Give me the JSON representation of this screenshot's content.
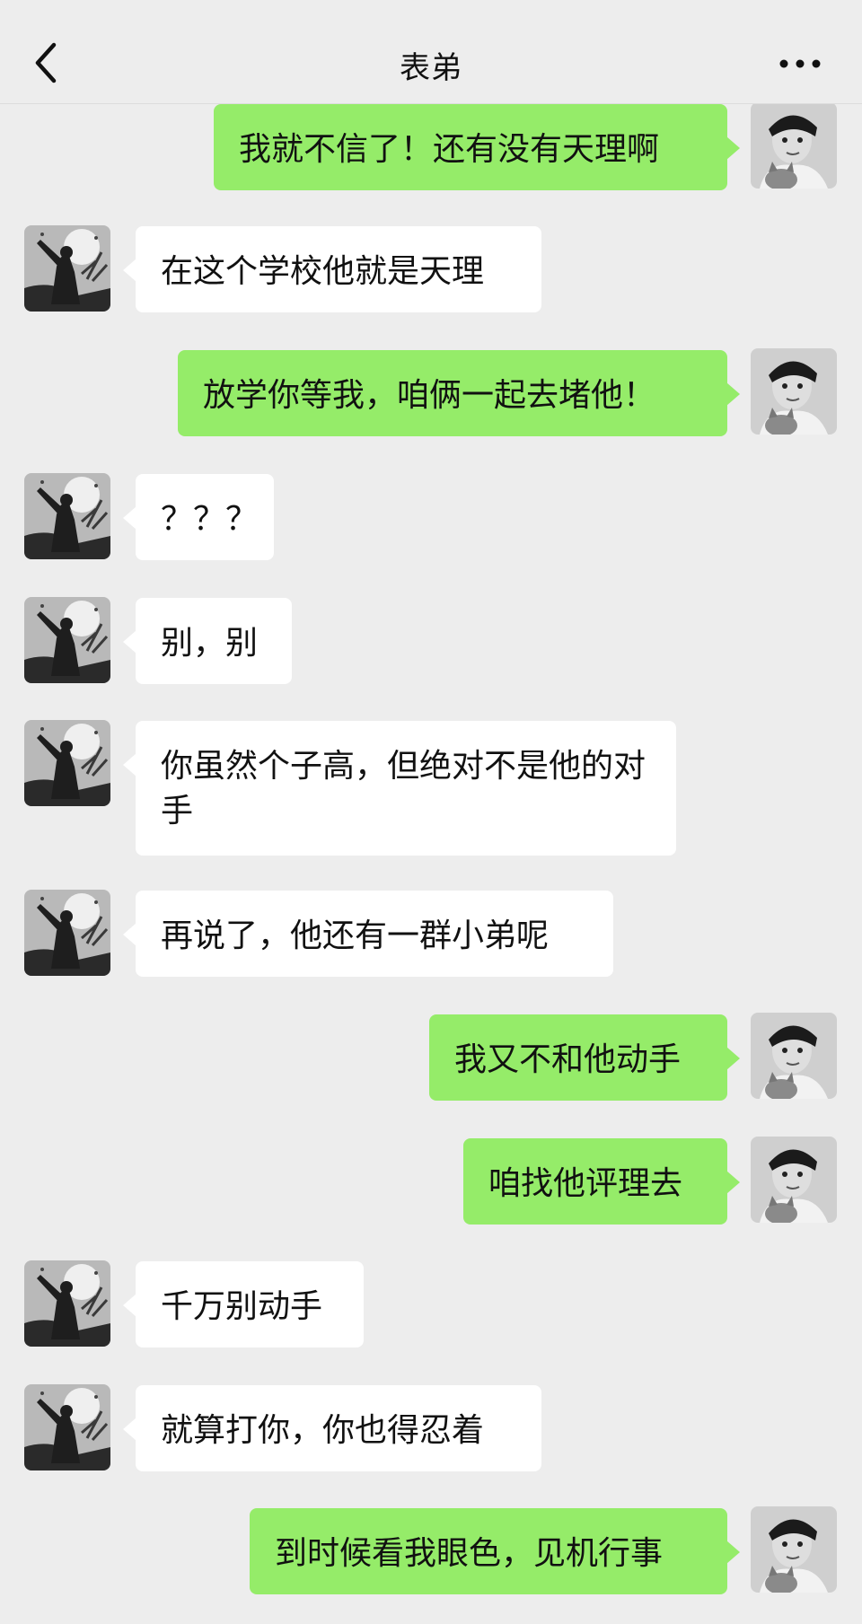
{
  "header": {
    "title": "表弟",
    "back_icon": "chevron-left-icon",
    "more_icon": "more-dots-icon"
  },
  "colors": {
    "background": "#ededed",
    "my_bubble": "#95ec69",
    "their_bubble": "#ffffff"
  },
  "messages": [
    {
      "sender": "me",
      "text": "我就不信了！还有没有天理啊"
    },
    {
      "sender": "them",
      "text": "在这个学校他就是天理"
    },
    {
      "sender": "me",
      "text": "放学你等我，咱俩一起去堵他！"
    },
    {
      "sender": "them",
      "text": "？？？"
    },
    {
      "sender": "them",
      "text": "别，别"
    },
    {
      "sender": "them",
      "text": "你虽然个子高，但绝对不是他的对手"
    },
    {
      "sender": "them",
      "text": "再说了，他还有一群小弟呢"
    },
    {
      "sender": "me",
      "text": "我又不和他动手"
    },
    {
      "sender": "me",
      "text": "咱找他评理去"
    },
    {
      "sender": "them",
      "text": "千万别动手"
    },
    {
      "sender": "them",
      "text": "就算打你，你也得忍着"
    },
    {
      "sender": "me",
      "text": "到时候看我眼色，见机行事"
    }
  ]
}
